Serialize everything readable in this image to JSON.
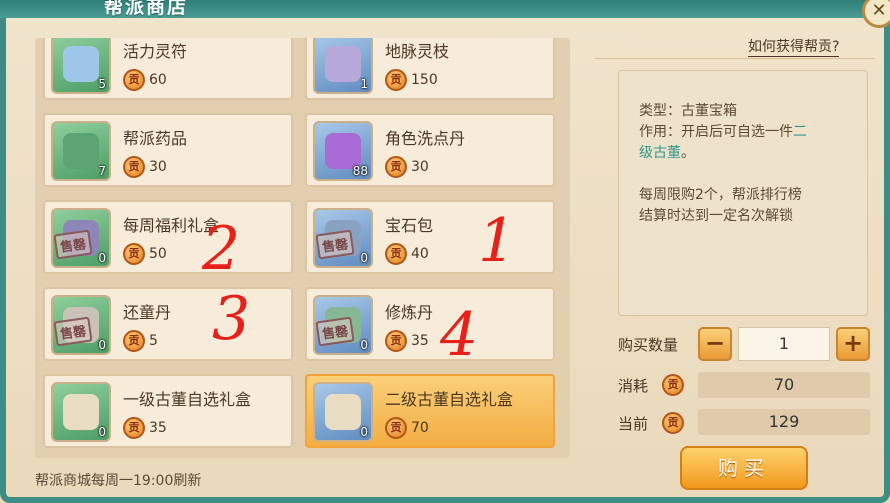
{
  "title": "帮派商店",
  "close_icon": "close-icon",
  "items": [
    {
      "name": "活力灵符",
      "price": "60",
      "qty": "5",
      "icon": "scroll-icon",
      "color": "#9ec6e8",
      "sold_out": false,
      "selected": false
    },
    {
      "name": "地脉灵枝",
      "price": "150",
      "qty": "1",
      "icon": "branch-icon",
      "color": "#b7a8da",
      "sold_out": false,
      "selected": false
    },
    {
      "name": "帮派药品",
      "price": "30",
      "qty": "7",
      "icon": "bag-icon",
      "color": "#5ba574",
      "sold_out": false,
      "selected": false
    },
    {
      "name": "角色洗点丹",
      "price": "30",
      "qty": "88",
      "icon": "orb-icon",
      "color": "#a96bd6",
      "sold_out": false,
      "selected": false
    },
    {
      "name": "每周福利礼盒",
      "price": "50",
      "qty": "0",
      "icon": "gift-box-icon",
      "color": "#8e86b8",
      "sold_out": true,
      "selected": false
    },
    {
      "name": "宝石包",
      "price": "40",
      "qty": "0",
      "icon": "gem-pack-icon",
      "color": "#8aa2c2",
      "sold_out": true,
      "selected": false
    },
    {
      "name": "还童丹",
      "price": "5",
      "qty": "0",
      "icon": "vase-icon",
      "color": "#c8c2b8",
      "sold_out": true,
      "selected": false
    },
    {
      "name": "修炼丹",
      "price": "35",
      "qty": "0",
      "icon": "vase-icon",
      "color": "#86b896",
      "sold_out": true,
      "selected": false
    },
    {
      "name": "一级古董自选礼盒",
      "price": "35",
      "qty": "0",
      "icon": "chest-icon",
      "color": "#e8dcc2",
      "sold_out": false,
      "selected": false
    },
    {
      "name": "二级古董自选礼盒",
      "price": "70",
      "qty": "0",
      "icon": "chest-icon",
      "color": "#e8dcc2",
      "sold_out": false,
      "selected": true
    }
  ],
  "currency_symbol": "贡",
  "sold_out_label": "售罄",
  "footnote": "帮派商城每周一19:00刷新",
  "how_to_get": "如何获得帮贡?",
  "desc": {
    "line1": "类型：古董宝箱",
    "line2_pre": "作用：开启后可自选一件",
    "line2_hl": "二",
    "line3_hl": "级古董",
    "line3_post": "。",
    "line4": "每周限购2个，帮派排行榜",
    "line5": "结算时达到一定名次解锁"
  },
  "purchase": {
    "qty_label": "购买数量",
    "minus": "−",
    "qty_value": "1",
    "plus": "+",
    "cost_label": "消耗",
    "cost_value": "70",
    "current_label": "当前",
    "current_value": "129",
    "buy_label": "购买"
  },
  "annotations": [
    "2",
    "1",
    "3",
    "4"
  ]
}
